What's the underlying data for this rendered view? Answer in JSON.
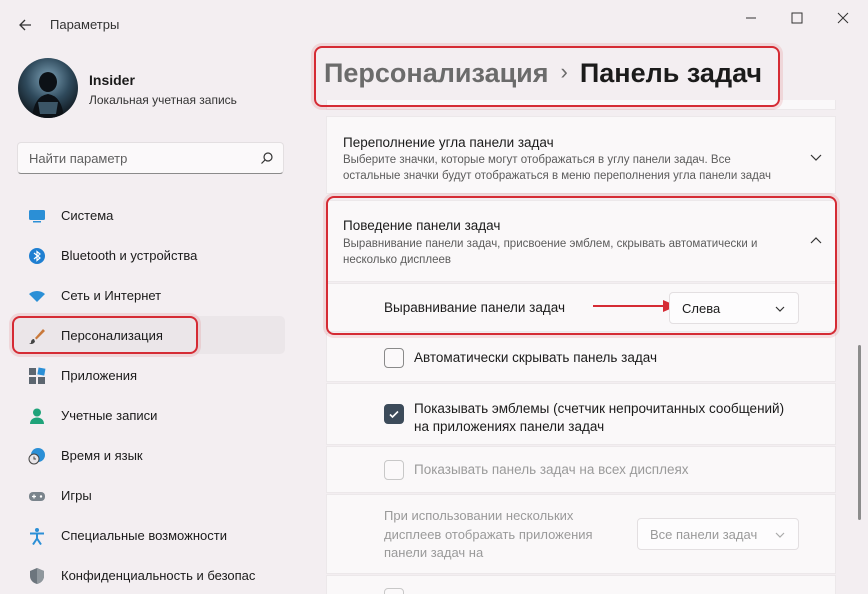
{
  "app": {
    "title": "Параметры"
  },
  "window_controls": {
    "minimize": "minimize-icon",
    "maximize": "maximize-icon",
    "close": "close-icon"
  },
  "profile": {
    "name": "Insider",
    "subtitle": "Локальная учетная запись"
  },
  "search": {
    "placeholder": "Найти параметр"
  },
  "sidebar": {
    "items": [
      {
        "label": "Система",
        "icon": "monitor-icon"
      },
      {
        "label": "Bluetooth и устройства",
        "icon": "bluetooth-icon"
      },
      {
        "label": "Сеть и Интернет",
        "icon": "wifi-icon"
      },
      {
        "label": "Персонализация",
        "icon": "brush-icon",
        "active": true
      },
      {
        "label": "Приложения",
        "icon": "apps-icon"
      },
      {
        "label": "Учетные записи",
        "icon": "person-icon"
      },
      {
        "label": "Время и язык",
        "icon": "clock-globe-icon"
      },
      {
        "label": "Игры",
        "icon": "gamepad-icon"
      },
      {
        "label": "Специальные возможности",
        "icon": "accessibility-icon"
      },
      {
        "label": "Конфиденциальность и безопас",
        "icon": "shield-icon"
      }
    ]
  },
  "breadcrumb": {
    "parent": "Персонализация",
    "separator": "›",
    "current": "Панель задач"
  },
  "overflow_card": {
    "title": "Переполнение угла панели задач",
    "description": "Выберите значки, которые могут отображаться в углу панели задач. Все остальные значки будут отображаться в меню переполнения угла панели задач"
  },
  "behavior_card": {
    "title": "Поведение панели задач",
    "description": "Выравнивание панели задач, присвоение эмблем, скрывать автоматически и несколько дисплеев",
    "alignment_label": "Выравнивание панели задач",
    "alignment_value": "Слева",
    "autohide_label": "Автоматически скрывать панель задач",
    "autohide_checked": false,
    "badges_label_line1": "Показывать эмблемы (счетчик непрочитанных сообщений)",
    "badges_label_line2": "на приложениях панели задач",
    "badges_checked": true,
    "all_displays_label": "Показывать панель задач на всех дисплеях",
    "all_displays_checked": false,
    "multi_display_line1": "При использовании нескольких",
    "multi_display_line2": "дисплеев отображать приложения",
    "multi_display_line3": "панели задач на",
    "multi_display_value": "Все панели задач"
  },
  "colors": {
    "accent": "#d52b34",
    "checkbox_checked": "#3c4b5a",
    "background": "#f3eef1"
  }
}
